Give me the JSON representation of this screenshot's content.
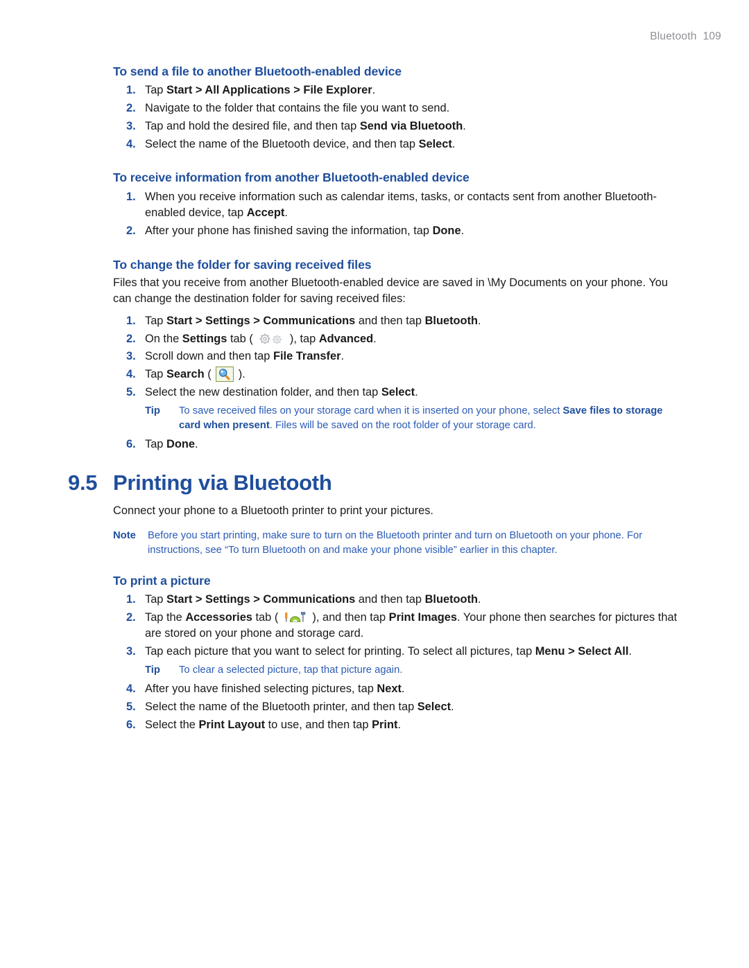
{
  "page_header": {
    "chapter": "Bluetooth",
    "page_number": "109"
  },
  "colors": {
    "heading_blue": "#1F4E9C",
    "callout_blue": "#2B5BB5",
    "body_black": "#1A1A1A",
    "header_gray": "#8D8F93",
    "search_icon_border": "#7E9A3D"
  },
  "sections": {
    "send_file": {
      "heading": "To send a file to another Bluetooth-enabled device",
      "steps": [
        {
          "num": "1.",
          "parts": [
            {
              "t": "Tap ",
              "b": false
            },
            {
              "t": "Start > All Applications > File Explorer",
              "b": true
            },
            {
              "t": ".",
              "b": false
            }
          ]
        },
        {
          "num": "2.",
          "parts": [
            {
              "t": "Navigate to the folder that contains the file you want to send.",
              "b": false
            }
          ]
        },
        {
          "num": "3.",
          "parts": [
            {
              "t": "Tap and hold the desired file, and then tap ",
              "b": false
            },
            {
              "t": "Send via Bluetooth",
              "b": true
            },
            {
              "t": ".",
              "b": false
            }
          ]
        },
        {
          "num": "4.",
          "parts": [
            {
              "t": "Select the name of the Bluetooth device, and then tap ",
              "b": false
            },
            {
              "t": "Select",
              "b": true
            },
            {
              "t": ".",
              "b": false
            }
          ]
        }
      ]
    },
    "receive_info": {
      "heading": "To receive information from another Bluetooth-enabled device",
      "steps": [
        {
          "num": "1.",
          "parts": [
            {
              "t": "When you receive information such as calendar items, tasks, or contacts sent from another Bluetooth-enabled device, tap ",
              "b": false
            },
            {
              "t": "Accept",
              "b": true
            },
            {
              "t": ".",
              "b": false
            }
          ]
        },
        {
          "num": "2.",
          "parts": [
            {
              "t": "After your phone has finished saving the information, tap ",
              "b": false
            },
            {
              "t": "Done",
              "b": true
            },
            {
              "t": ".",
              "b": false
            }
          ]
        }
      ]
    },
    "change_folder": {
      "heading": "To change the folder for saving received files",
      "intro": "Files that you receive from another Bluetooth-enabled device are saved in \\My Documents on your phone. You can change the destination folder for saving received files:",
      "steps": [
        {
          "num": "1.",
          "parts": [
            {
              "t": "Tap ",
              "b": false
            },
            {
              "t": "Start > Settings > Communications",
              "b": true
            },
            {
              "t": " and then tap ",
              "b": false
            },
            {
              "t": "Bluetooth",
              "b": true
            },
            {
              "t": ".",
              "b": false
            }
          ]
        },
        {
          "num": "2.",
          "parts": [
            {
              "t": "On the ",
              "b": false
            },
            {
              "t": "Settings",
              "b": true
            },
            {
              "t": " tab ( ",
              "b": false
            },
            {
              "icon": "gears-icon"
            },
            {
              "t": " ), tap ",
              "b": false
            },
            {
              "t": "Advanced",
              "b": true
            },
            {
              "t": ".",
              "b": false
            }
          ]
        },
        {
          "num": "3.",
          "parts": [
            {
              "t": "Scroll down and then tap ",
              "b": false
            },
            {
              "t": "File Transfer",
              "b": true
            },
            {
              "t": ".",
              "b": false
            }
          ]
        },
        {
          "num": "4.",
          "parts": [
            {
              "t": "Tap ",
              "b": false
            },
            {
              "t": "Search",
              "b": true
            },
            {
              "t": " ( ",
              "b": false
            },
            {
              "icon": "search-icon"
            },
            {
              "t": " ).",
              "b": false
            }
          ]
        },
        {
          "num": "5.",
          "parts": [
            {
              "t": "Select the new destination folder, and then tap ",
              "b": false
            },
            {
              "t": "Select",
              "b": true
            },
            {
              "t": ".",
              "b": false
            }
          ]
        },
        {
          "num": "6.",
          "parts": [
            {
              "t": "Tap ",
              "b": false
            },
            {
              "t": "Done",
              "b": true
            },
            {
              "t": ".",
              "b": false
            }
          ]
        }
      ],
      "tip": {
        "label": "Tip",
        "parts": [
          {
            "t": "To save received files on your storage card when it is inserted on your phone, select ",
            "b": false
          },
          {
            "t": "Save files to storage card when present",
            "b": true
          },
          {
            "t": ". Files will be saved on the root folder of your storage card.",
            "b": false
          }
        ]
      }
    },
    "printing": {
      "number": "9.5",
      "title": "Printing via Bluetooth",
      "intro": "Connect your phone to a Bluetooth printer to print your pictures.",
      "note": {
        "label": "Note",
        "parts": [
          {
            "t": "Before you start printing, make sure to turn on the Bluetooth printer and turn on Bluetooth on your phone. For instructions, see “To turn Bluetooth on and make your phone visible” earlier in this chapter.",
            "b": false
          }
        ]
      },
      "print_picture": {
        "heading": "To print a picture",
        "steps": [
          {
            "num": "1.",
            "parts": [
              {
                "t": "Tap ",
                "b": false
              },
              {
                "t": "Start > Settings > Communications",
                "b": true
              },
              {
                "t": " and then tap ",
                "b": false
              },
              {
                "t": "Bluetooth",
                "b": true
              },
              {
                "t": ".",
                "b": false
              }
            ]
          },
          {
            "num": "2.",
            "parts": [
              {
                "t": "Tap the ",
                "b": false
              },
              {
                "t": "Accessories",
                "b": true
              },
              {
                "t": " tab ( ",
                "b": false
              },
              {
                "icon": "accessories-icon"
              },
              {
                "t": " ), and then tap ",
                "b": false
              },
              {
                "t": "Print Images",
                "b": true
              },
              {
                "t": ". Your phone then searches for pictures that are stored on your phone and storage card.",
                "b": false
              }
            ]
          },
          {
            "num": "3.",
            "parts": [
              {
                "t": "Tap each picture that you want to select for printing. To select all pictures, tap ",
                "b": false
              },
              {
                "t": "Menu > Select All",
                "b": true
              },
              {
                "t": ".",
                "b": false
              }
            ]
          },
          {
            "num": "4.",
            "parts": [
              {
                "t": "After you have finished selecting pictures, tap ",
                "b": false
              },
              {
                "t": "Next",
                "b": true
              },
              {
                "t": ".",
                "b": false
              }
            ]
          },
          {
            "num": "5.",
            "parts": [
              {
                "t": "Select the name of the Bluetooth printer, and then tap ",
                "b": false
              },
              {
                "t": "Select",
                "b": true
              },
              {
                "t": ".",
                "b": false
              }
            ]
          },
          {
            "num": "6.",
            "parts": [
              {
                "t": "Select the ",
                "b": false
              },
              {
                "t": "Print Layout",
                "b": true
              },
              {
                "t": " to use, and then tap ",
                "b": false
              },
              {
                "t": "Print",
                "b": true
              },
              {
                "t": ".",
                "b": false
              }
            ]
          }
        ],
        "tip": {
          "label": "Tip",
          "parts": [
            {
              "t": "To clear a selected picture, tap that picture again.",
              "b": false
            }
          ]
        }
      }
    }
  }
}
